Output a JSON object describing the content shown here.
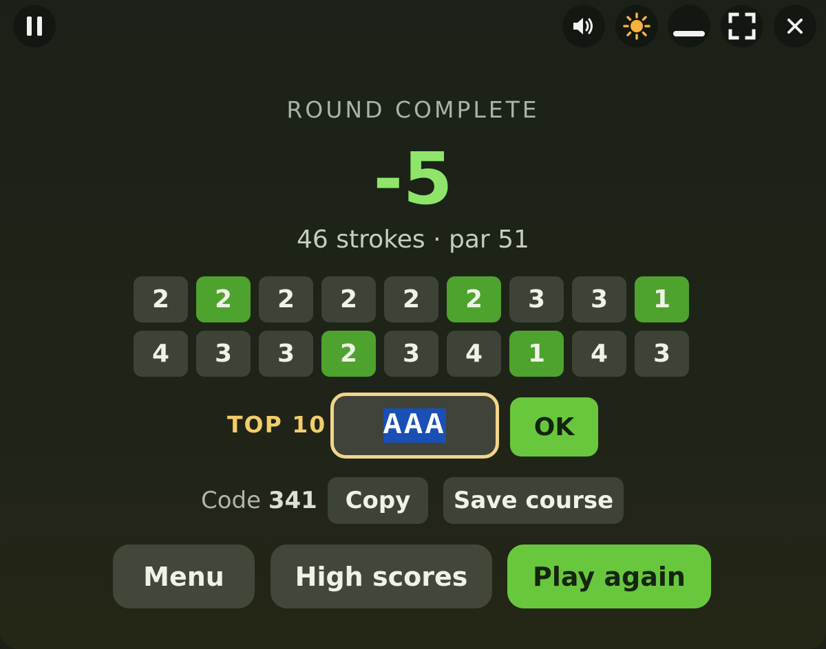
{
  "top_controls": {
    "pause_icon": "pause-icon",
    "sound_icon": "speaker-icon",
    "theme_icon": "sun-icon",
    "minimize_icon": "minimize-icon",
    "fullscreen_icon": "fullscreen-icon",
    "close_icon": "close-icon"
  },
  "result": {
    "title": "ROUND COMPLETE",
    "score": "-5",
    "strokes": "46 strokes · par 51"
  },
  "holes": [
    {
      "strokes": "2",
      "under_par": false
    },
    {
      "strokes": "2",
      "under_par": true
    },
    {
      "strokes": "2",
      "under_par": false
    },
    {
      "strokes": "2",
      "under_par": false
    },
    {
      "strokes": "2",
      "under_par": false
    },
    {
      "strokes": "2",
      "under_par": true
    },
    {
      "strokes": "3",
      "under_par": false
    },
    {
      "strokes": "3",
      "under_par": false
    },
    {
      "strokes": "1",
      "under_par": true
    },
    {
      "strokes": "4",
      "under_par": false
    },
    {
      "strokes": "3",
      "under_par": false
    },
    {
      "strokes": "3",
      "under_par": false
    },
    {
      "strokes": "2",
      "under_par": true
    },
    {
      "strokes": "3",
      "under_par": false
    },
    {
      "strokes": "4",
      "under_par": false
    },
    {
      "strokes": "1",
      "under_par": true
    },
    {
      "strokes": "4",
      "under_par": false
    },
    {
      "strokes": "3",
      "under_par": false
    }
  ],
  "entry": {
    "label": "TOP 10",
    "name_value": "AAA",
    "ok_label": "OK"
  },
  "course": {
    "code_label": "Code",
    "code_value": "341",
    "copy_label": "Copy",
    "save_label": "Save course"
  },
  "actions": {
    "menu_label": "Menu",
    "high_scores_label": "High scores",
    "play_again_label": "Play again"
  },
  "colors": {
    "accent_green": "#69c73d",
    "score_green": "#8ee56a",
    "under_par_cell": "#4ea22e",
    "cell": "#3e4338",
    "gold": "#f2cd6a"
  }
}
